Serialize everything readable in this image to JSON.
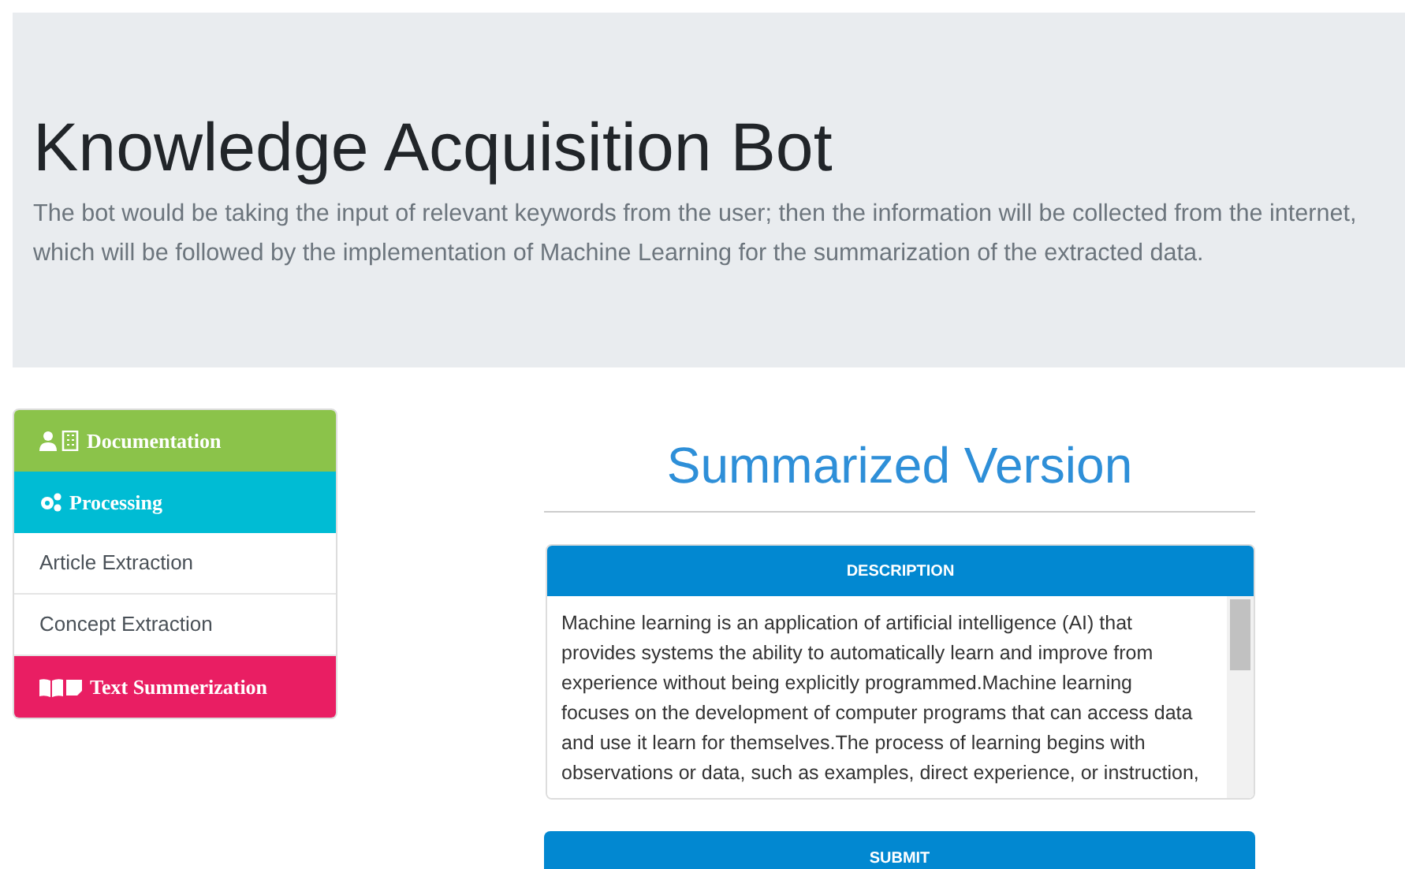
{
  "header": {
    "title": "Knowledge Acquisition Bot",
    "description": "The bot would be taking the input of relevant keywords from the user; then the information will be collected from the internet, which will be followed by the implementation of Machine Learning for the summarization of the extracted data."
  },
  "menu": [
    {
      "kind": "header",
      "label": "Documentation",
      "color": "#8bc34a"
    },
    {
      "kind": "header",
      "label": "Processing",
      "color": "#00bcd4"
    },
    {
      "kind": "link",
      "label": "Article Extraction"
    },
    {
      "kind": "link",
      "label": "Concept Extraction"
    },
    {
      "kind": "header",
      "label": "Text Summerization",
      "color": "#e91e63"
    }
  ],
  "main": {
    "title": "Summarized Version",
    "card_title": "DESCRIPTION",
    "text": "Machine learning is an application of artificial intelligence (AI) that provides systems the ability to automatically learn and improve from experience without being explicitly programmed.Machine learning focuses on the development of computer programs that can access data and use it learn for themselves.The process of learning begins with observations or data, such as examples, direct experience, or instruction,",
    "button": "SUBMIT"
  }
}
